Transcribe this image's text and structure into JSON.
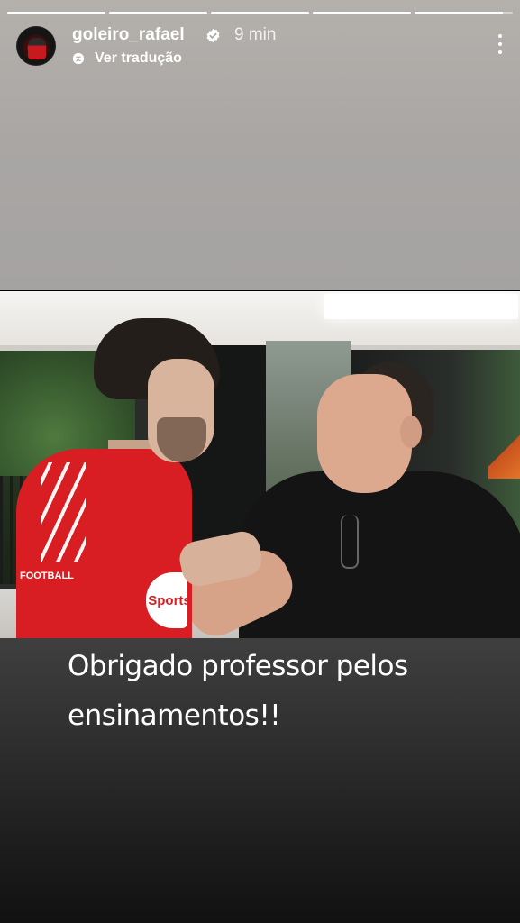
{
  "story": {
    "segments": [
      1,
      1,
      1,
      1,
      0.9
    ],
    "username": "goleiro_rafael",
    "verified": true,
    "time": "9 min",
    "translate_label": "Ver tradução",
    "caption": "Obrigado professor pelos\nensinamentos!!"
  },
  "photo": {
    "shirt_sponsor": "Sports",
    "shirt_badge": "FOOTBALL"
  },
  "icons": {
    "more": "more-vertical-icon",
    "translate": "translate-icon",
    "verified": "verified-badge-icon"
  },
  "colors": {
    "top_background": "#a9a6a4",
    "verified": "#ffffff"
  }
}
